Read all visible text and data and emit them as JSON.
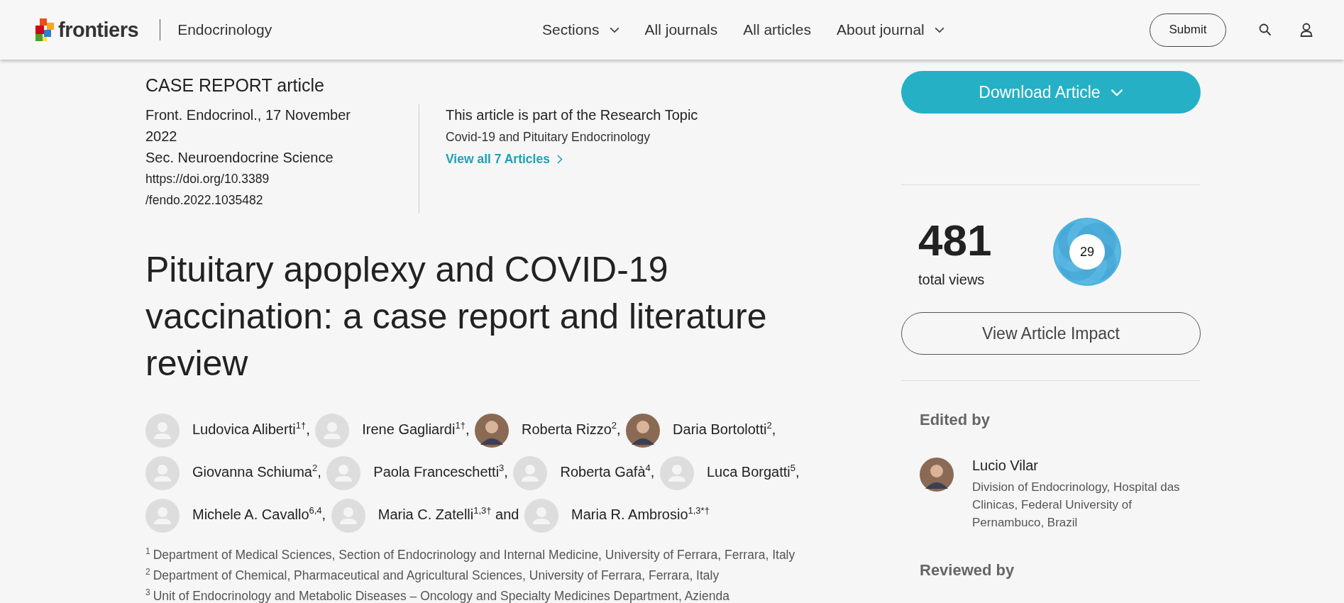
{
  "header": {
    "logo": "frontiers",
    "journal": "Endocrinology",
    "nav": [
      {
        "label": "Sections",
        "dropdown": true
      },
      {
        "label": "All journals",
        "dropdown": false
      },
      {
        "label": "All articles",
        "dropdown": false
      },
      {
        "label": "About journal",
        "dropdown": true
      }
    ],
    "submit": "Submit"
  },
  "article": {
    "type": "CASE REPORT article",
    "citation": "Front. Endocrinol., 17 November 2022",
    "section": "Sec. Neuroendocrine Science",
    "doi_lines": [
      "https://doi.org/10.3389",
      "/fendo.2022.1035482"
    ],
    "research_topic": {
      "heading": "This article is part of the Research Topic",
      "name": "Covid-19 and Pituitary Endocrinology",
      "link": "View all 7 Articles"
    },
    "title": "Pituitary apoplexy and COVID-19 vaccination: a case report and literature review",
    "authors": [
      {
        "name": "Ludovica Aliberti$^{1†}$,",
        "photo": false
      },
      {
        "name": "Irene Gagliardi$^{1†}$,",
        "photo": false
      },
      {
        "name": "Roberta Rizzo$^{2}$,",
        "photo": true
      },
      {
        "name": "Daria Bortolotti$^{2}$,",
        "photo": true
      },
      {
        "name": "Giovanna Schiuma$^{2}$,",
        "photo": false
      },
      {
        "name": "Paola Franceschetti$^{3}$,",
        "photo": false
      },
      {
        "name": "Roberta Gafà$^{4}$,",
        "photo": false
      },
      {
        "name": "Luca Borgatti$^{5}$,",
        "photo": false
      },
      {
        "name": "Michele A. Cavallo$^{6,4}$,",
        "photo": false
      },
      {
        "name": "Maria C. Zatelli$^{1,3†}$ and",
        "photo": false
      },
      {
        "name": "Maria R. Ambrosio$^{1,3*†}$",
        "photo": false
      }
    ],
    "affiliations": [
      {
        "mark": "1",
        "text": "Department of Medical Sciences, Section of Endocrinology and Internal Medicine, University of Ferrara, Ferrara, Italy"
      },
      {
        "mark": "2",
        "text": "Department of Chemical, Pharmaceutical and Agricultural Sciences, University of Ferrara, Ferrara, Italy"
      },
      {
        "mark": "3",
        "text": "Unit of Endocrinology and Metabolic Diseases – Oncology and Specialty Medicines Department, Azienda"
      }
    ]
  },
  "sidebar": {
    "download": "Download Article",
    "views": "481",
    "views_label": "total views",
    "attention_score": "29",
    "impact_button": "View Article Impact",
    "edited_by": "Edited by",
    "editors": [
      {
        "name": "Lucio Vilar",
        "affiliation": "Division of Endocrinology, Hospital das Clinicas, Federal University of Pernambuco, Brazil",
        "photo": true
      }
    ],
    "reviewed_by": "Reviewed by"
  }
}
